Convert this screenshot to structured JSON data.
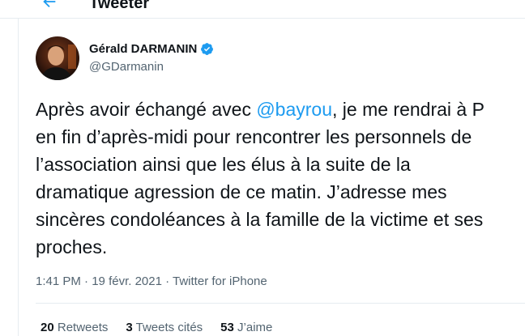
{
  "header": {
    "title": "Tweeter",
    "back_icon": "arrow-left-icon",
    "accent": "#1d9bf0"
  },
  "author": {
    "name": "Gérald DARMANIN",
    "handle": "@GDarmanin",
    "verified_icon": "verified-badge-icon",
    "verified_color": "#1d9bf0"
  },
  "tweet": {
    "line1_before": "Après avoir échangé avec ",
    "mention": "@bayrou",
    "line1_after": ", je me rendrai à P",
    "line2": "en fin d’après-midi pour rencontrer les personnels de",
    "line3": "l’association ainsi que les élus à la suite de la",
    "line4": "dramatique agression de ce matin. J’adresse mes",
    "line5": "sincères condoléances à la famille de la victime et ses",
    "line6": "proches."
  },
  "meta": {
    "time": "1:41 PM",
    "sep1": " · ",
    "date": "19 févr. 2021",
    "sep2": " · ",
    "source": "Twitter for iPhone"
  },
  "stats": {
    "retweets_count": "20",
    "retweets_label": "Retweets",
    "quotes_count": "3",
    "quotes_label": "Tweets cités",
    "likes_count": "53",
    "likes_label": "J’aime"
  }
}
